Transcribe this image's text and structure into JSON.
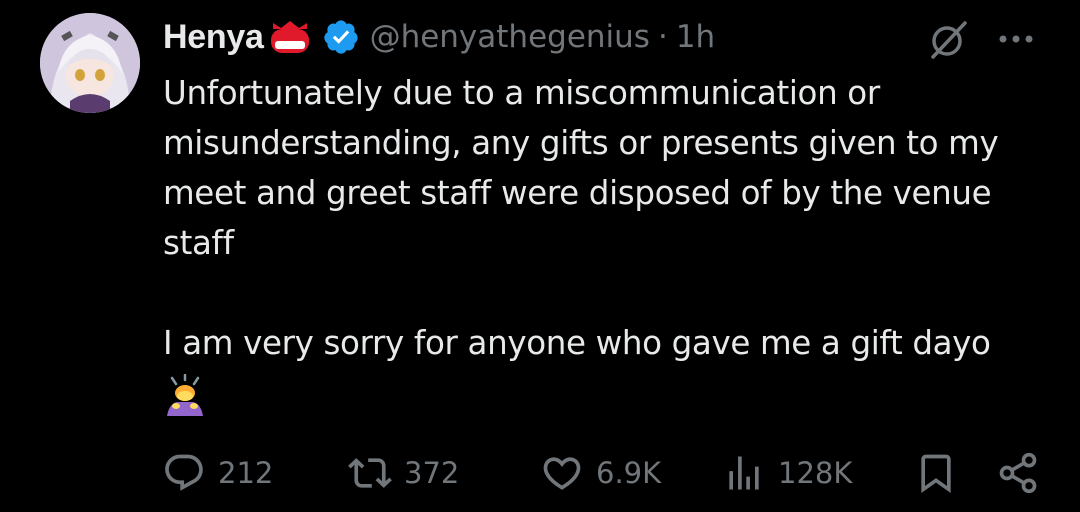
{
  "colors": {
    "background": "#000000",
    "text": "#e7e9ea",
    "muted": "#71767b",
    "verified": "#1d9bf0"
  },
  "author": {
    "name": "Henya",
    "handle": "@henyathegenius",
    "separator": "·",
    "time": "1h",
    "avatar_icon": "avatar-anime-girl",
    "name_badge_icon": "indonesia-flag-crown-icon",
    "verified_icon": "verified-badge-icon"
  },
  "header_actions": {
    "grok_icon": "grok-icon",
    "more_icon": "more-icon"
  },
  "tweet": {
    "lines": [
      "Unfortunately due to a miscommunication or",
      "misunderstanding, any gifts or presents given to my",
      "meet and greet staff were disposed of by the venue",
      "staff",
      "",
      "I am very sorry for anyone who gave me a gift dayo"
    ],
    "trailing_emoji": "person-bowing-emoji"
  },
  "actions": {
    "replies": {
      "icon": "reply-icon",
      "count": "212"
    },
    "reposts": {
      "icon": "repost-icon",
      "count": "372"
    },
    "likes": {
      "icon": "heart-icon",
      "count": "6.9K"
    },
    "views": {
      "icon": "analytics-icon",
      "count": "128K"
    },
    "bookmark": {
      "icon": "bookmark-icon"
    },
    "share": {
      "icon": "share-icon"
    }
  }
}
